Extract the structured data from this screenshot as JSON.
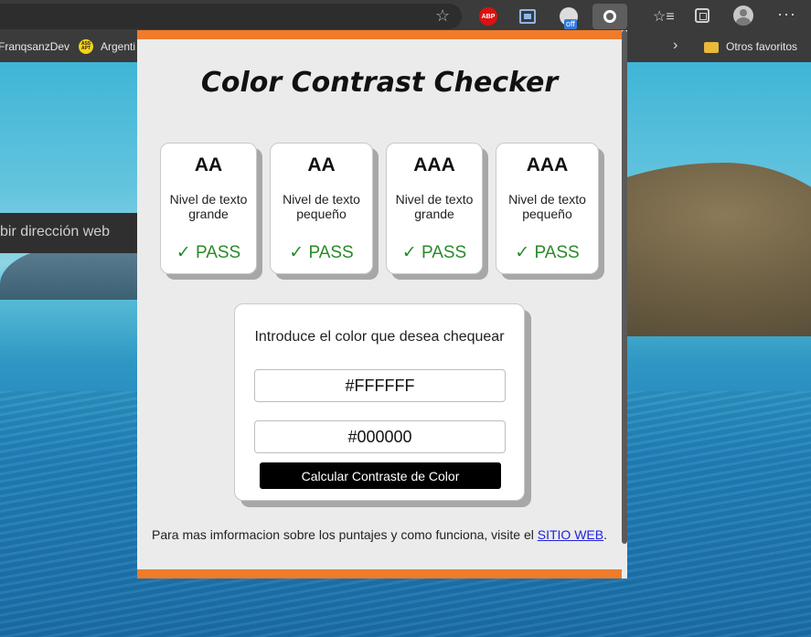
{
  "browser": {
    "bookmarks": [
      "FranqsanzDev",
      "Argenti",
      "Otros favoritos"
    ],
    "address_placeholder": "bir dirección web",
    "extension_badge": "off",
    "abp_label": "ABP",
    "bm_icon_text": "ASS APT"
  },
  "popup": {
    "title": "Color Contrast Checker",
    "cards": [
      {
        "level": "AA",
        "desc": "Nivel de texto grande",
        "result": "✓ PASS"
      },
      {
        "level": "AA",
        "desc": "Nivel de texto pequeño",
        "result": "✓ PASS"
      },
      {
        "level": "AAA",
        "desc": "Nivel de texto grande",
        "result": "✓ PASS"
      },
      {
        "level": "AAA",
        "desc": "Nivel de texto pequeño",
        "result": "✓ PASS"
      }
    ],
    "form": {
      "prompt": "Introduce el color que desea chequear",
      "color1": "#FFFFFF",
      "color2": "#000000",
      "button": "Calcular Contraste de Color"
    },
    "footer": {
      "text_before": "Para mas imformacion sobre los puntajes y como funciona, visite el ",
      "link": "SITIO WEB",
      "text_after": "."
    },
    "colors": {
      "accent": "#f07b2a",
      "pass": "#2a8a2a",
      "button_bg": "#000000"
    }
  }
}
